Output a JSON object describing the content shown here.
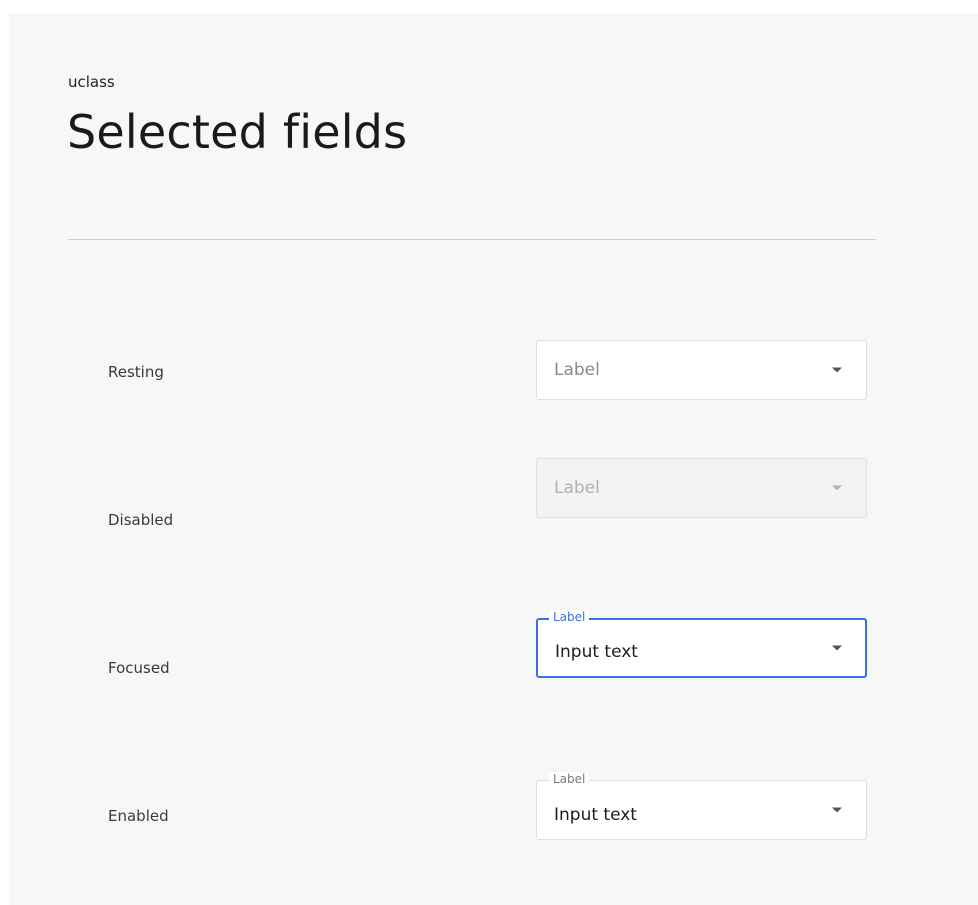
{
  "header": {
    "eyebrow": "uclass",
    "title": "Selected fields"
  },
  "rows": [
    {
      "state_label": "Resting",
      "placeholder": "Label"
    },
    {
      "state_label": "Disabled",
      "placeholder": "Label"
    },
    {
      "state_label": "Focused",
      "floating_label": "Label",
      "value": "Input text"
    },
    {
      "state_label": "Enabled",
      "floating_label": "Label",
      "value": "Input text"
    }
  ],
  "colors": {
    "focus_accent": "#3f6ee6",
    "panel_background": "#f7f7f7"
  },
  "icons": {
    "select_caret": "caret-down-icon"
  }
}
